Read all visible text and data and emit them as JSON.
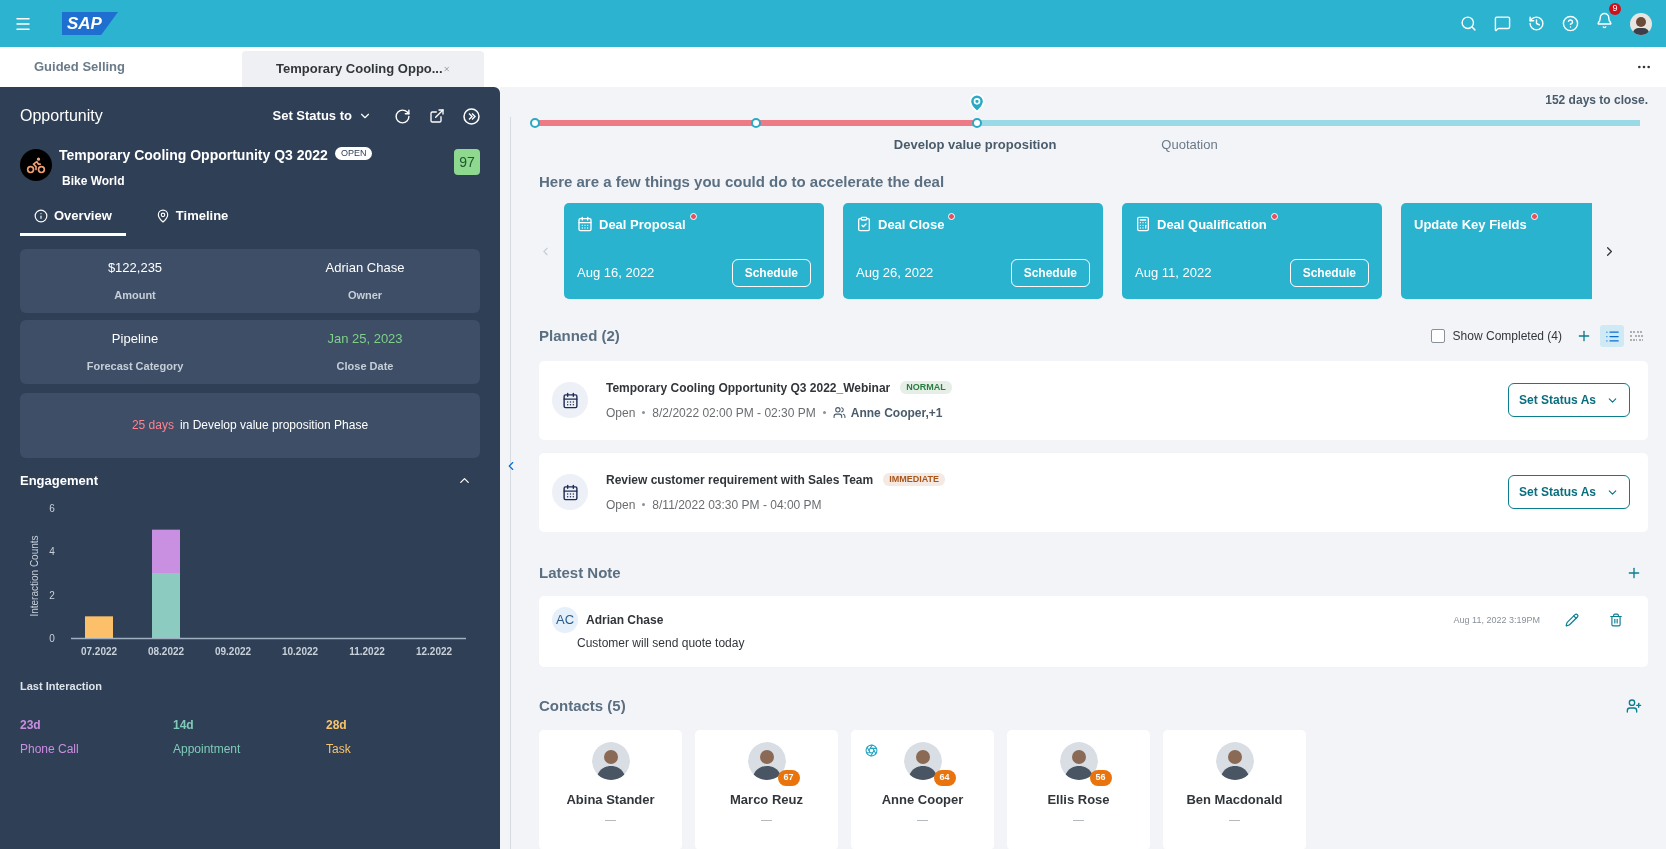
{
  "top_bar": {
    "logo": "SAP",
    "notification_count": "9"
  },
  "tabs": [
    {
      "label": "Guided Selling",
      "selected": false,
      "closable": false
    },
    {
      "label": "Temporary Cooling Oppo...",
      "selected": true,
      "closable": true
    }
  ],
  "opportunity_panel": {
    "title": "Opportunity",
    "status_button": "Set Status to",
    "name": "Temporary Cooling Opportunity Q3 2022",
    "status": "OPEN",
    "account": "Bike World",
    "score": "97",
    "tabs": [
      {
        "label": "Overview",
        "kind": "info",
        "selected": true
      },
      {
        "label": "Timeline",
        "kind": "timeline",
        "selected": false
      }
    ],
    "field_cards": [
      {
        "fields": [
          {
            "value": "$122,235",
            "label": "Amount",
            "highlight": false
          },
          {
            "value": "Adrian Chase",
            "label": "Owner",
            "highlight": false
          }
        ]
      },
      {
        "fields": [
          {
            "value": "Pipeline",
            "label": "Forecast Category",
            "highlight": false
          },
          {
            "value": "Jan 25, 2023",
            "label": "Close Date",
            "highlight": true
          }
        ]
      }
    ],
    "phase": {
      "days": "25 days",
      "text": "in Develop value proposition Phase"
    },
    "engagement": {
      "title": "Engagement",
      "expanded": true,
      "chart_data": {
        "type": "bar",
        "stacked": true,
        "ylabel": "Interaction Counts",
        "categories": [
          "07.2022",
          "08.2022",
          "09.2022",
          "10.2022",
          "11.2022",
          "12.2022"
        ],
        "ylim": [
          0,
          6
        ],
        "yticks": [
          0,
          2,
          4,
          6
        ],
        "series": [
          {
            "color": "#fcc06a",
            "values": [
              1,
              0,
              0,
              0,
              0,
              0
            ]
          },
          {
            "color": "#8ccbbf",
            "values": [
              0,
              3,
              0,
              0,
              0,
              0
            ]
          },
          {
            "color": "#c98fe0",
            "values": [
              0,
              2,
              0,
              0,
              0,
              0
            ]
          }
        ]
      }
    },
    "last_interaction": {
      "title": "Last Interaction",
      "items": [
        {
          "value": "23d",
          "label": "Phone Call",
          "color": "#c98fe0"
        },
        {
          "value": "14d",
          "label": "Appointment",
          "color": "#7fcbb9"
        },
        {
          "value": "28d",
          "label": "Task",
          "color": "#f8c46e"
        }
      ]
    }
  },
  "deal_progress": {
    "level": 0.4,
    "days_to_close": "152 days to close.",
    "stages": [
      {
        "label": "Develop value proposition",
        "selected": true
      },
      {
        "label": "Quotation",
        "selected": false
      }
    ]
  },
  "suggestions": {
    "title": "Here are a few things you could do to accelerate the deal",
    "cards": [
      {
        "title": "Deal Proposal",
        "kind": "calendar",
        "required": true,
        "date": "Aug 16, 2022",
        "button": "Schedule"
      },
      {
        "title": "Deal Close",
        "kind": "clipboard",
        "required": true,
        "date": "Aug 26, 2022",
        "button": "Schedule"
      },
      {
        "title": "Deal Qualification",
        "kind": "calculator",
        "required": true,
        "date": "Aug 11, 2022",
        "button": "Schedule"
      },
      {
        "title": "Update Key Fields",
        "kind": "none",
        "required": true
      }
    ]
  },
  "planned": {
    "title": "Planned (2)",
    "show_completed": {
      "label": "Show Completed (4)",
      "checked": false
    },
    "views": [
      {
        "kind": "list",
        "selected": true
      },
      {
        "kind": "timeline",
        "selected": false
      }
    ],
    "activities": [
      {
        "title": "Temporary Cooling Opportunity Q3 2022_Webinar",
        "tag": {
          "text": "NORMAL",
          "color": "#2b7d3f"
        },
        "status": "Open",
        "time": "8/2/2022 02:00 PM - 02:30 PM",
        "attendees": "Anne Cooper,+1",
        "button": "Set Status As"
      },
      {
        "title": "Review customer requirement with Sales Team",
        "tag": {
          "text": "IMMEDIATE",
          "color": "#a8561c"
        },
        "status": "Open",
        "time": "8/11/2022 03:30 PM - 04:00 PM",
        "button": "Set Status As"
      }
    ]
  },
  "latest_note": {
    "title": "Latest Note",
    "initials": "AC",
    "author": "Adrian Chase",
    "text": "Customer will send quote today",
    "timestamp": "Aug 11, 2022 3:19PM"
  },
  "contacts": {
    "title": "Contacts (5)",
    "items": [
      {
        "name": "Abina Stander",
        "title": "—",
        "key_contact": false
      },
      {
        "name": "Marco Reuz",
        "score": "67",
        "title": "—",
        "key_contact": false
      },
      {
        "name": "Anne Cooper",
        "score": "64",
        "title": "—",
        "key_contact": true
      },
      {
        "name": "Ellis Rose",
        "score": "56",
        "title": "—",
        "key_contact": false
      },
      {
        "name": "Ben Macdonald",
        "title": "—",
        "key_contact": false
      }
    ]
  }
}
